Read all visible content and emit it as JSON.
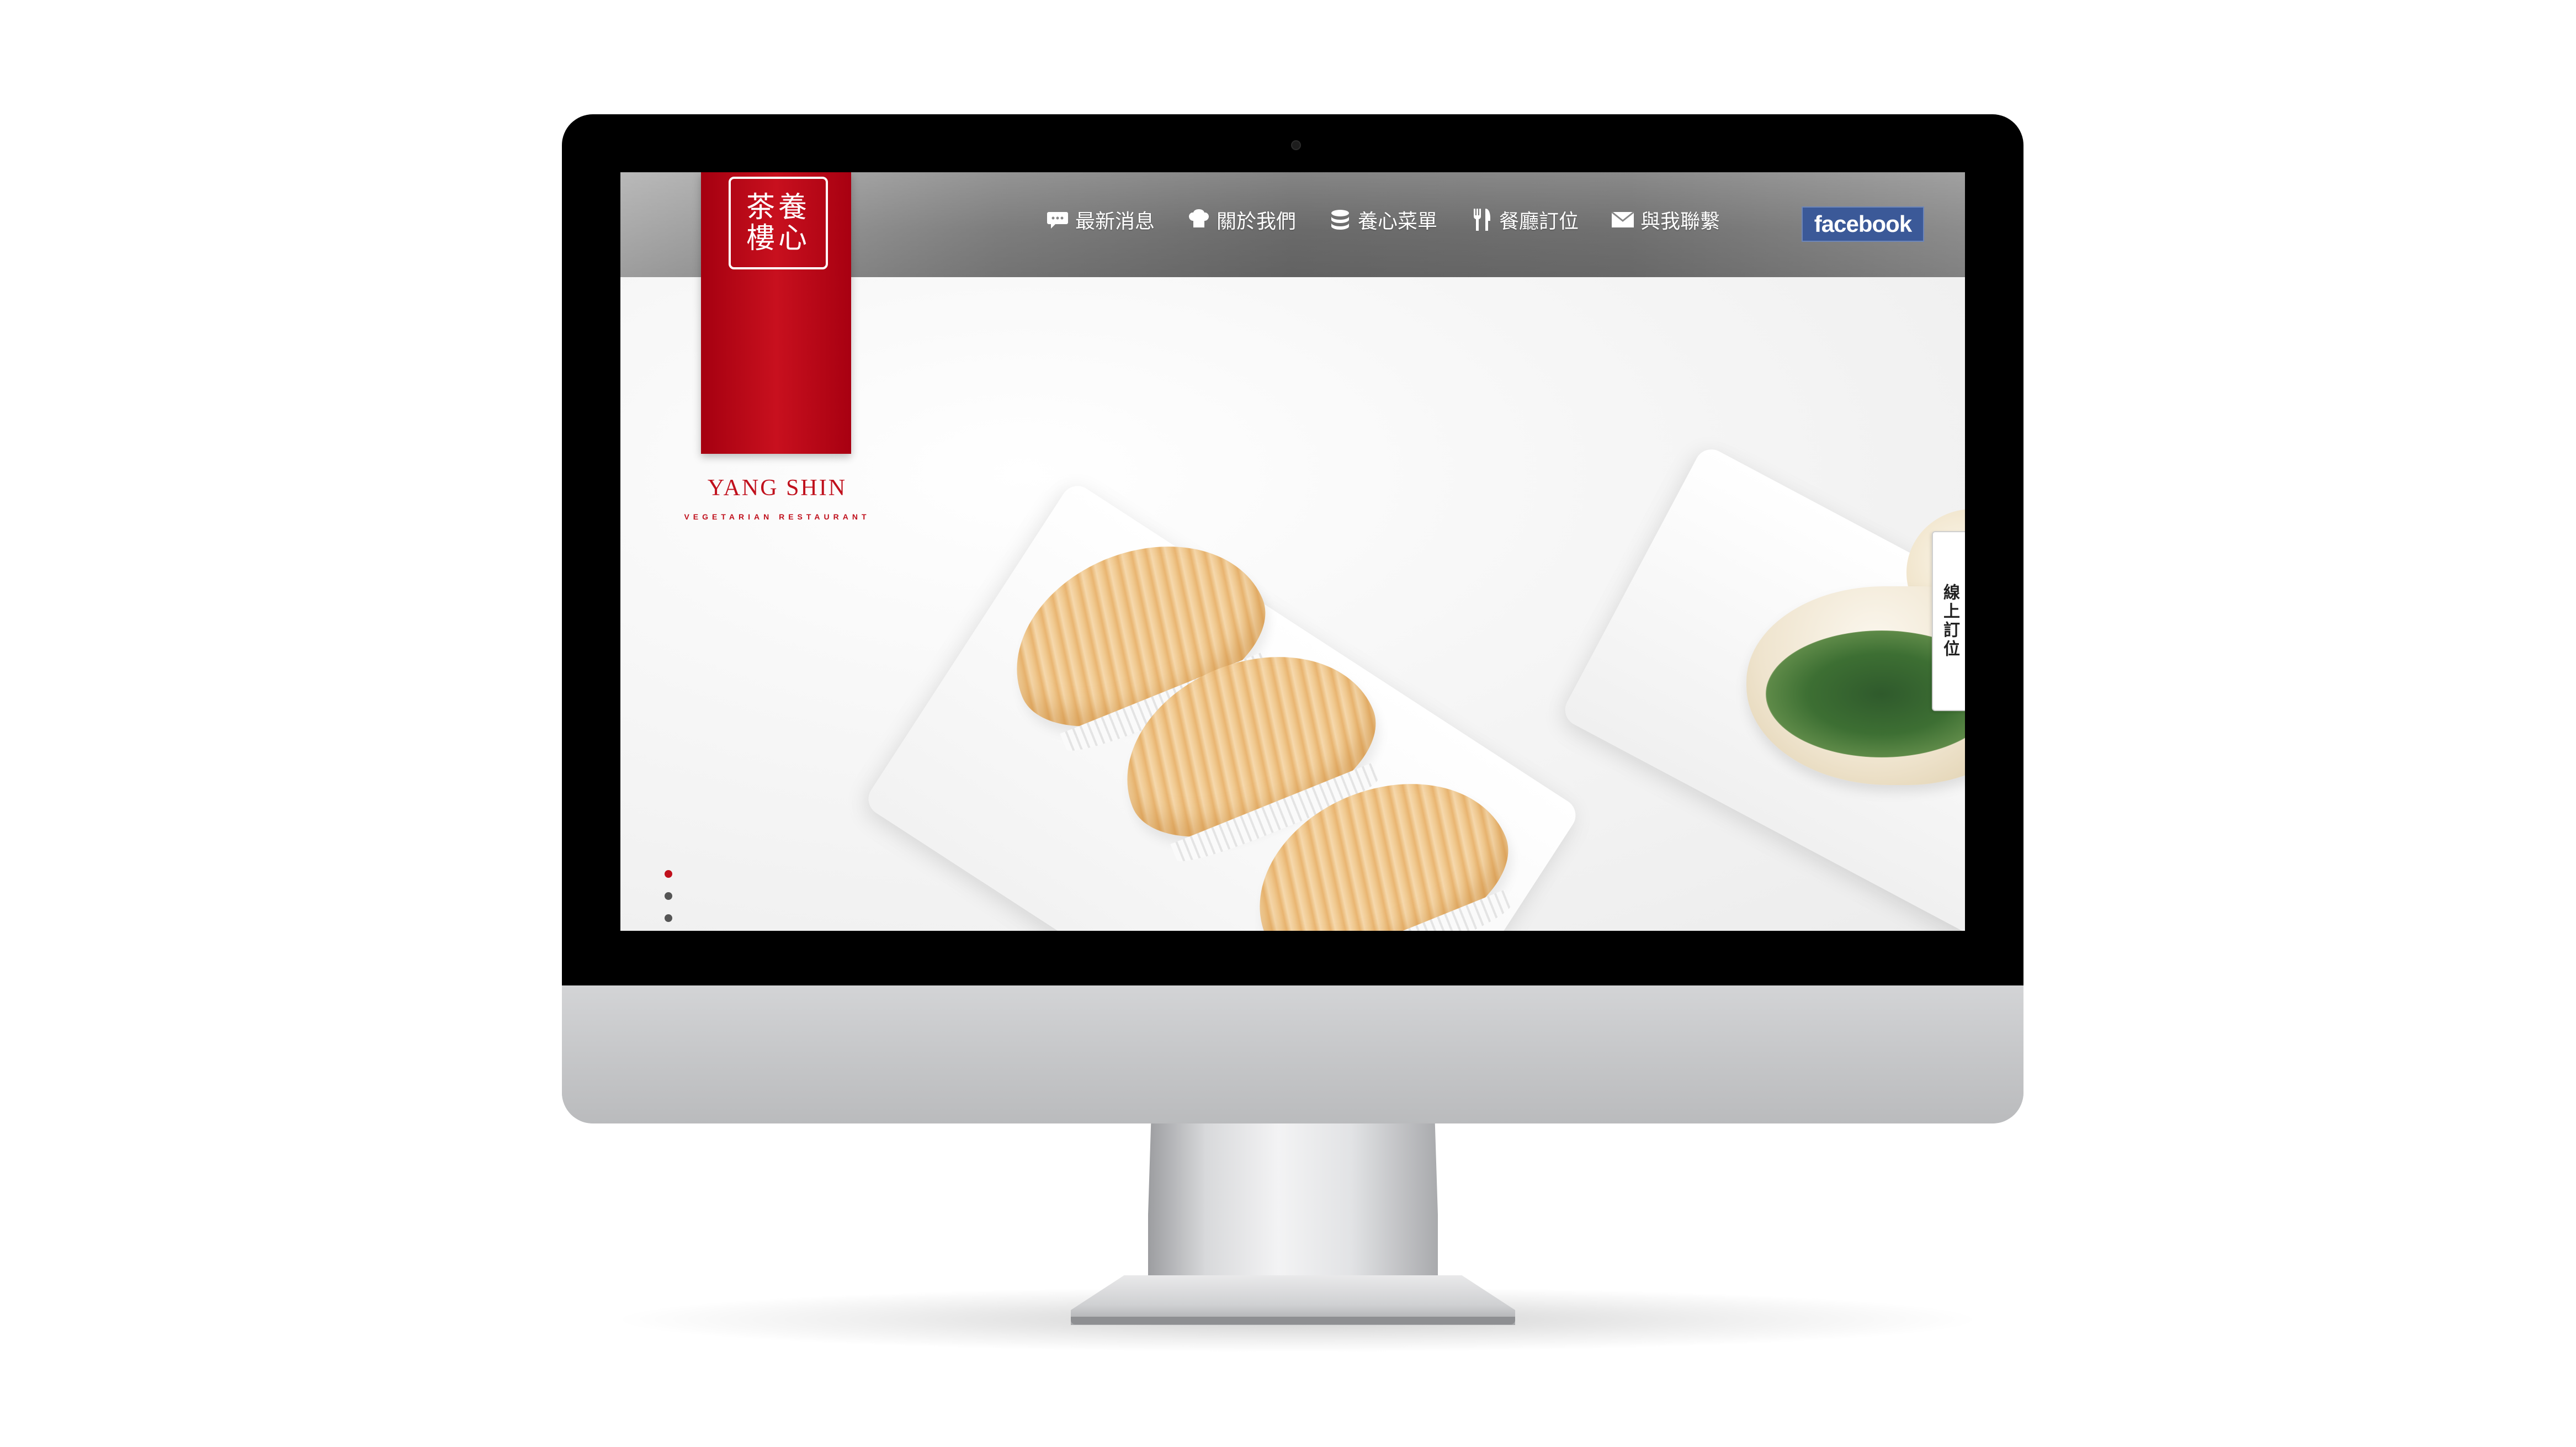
{
  "site": {
    "brand_name": "YANG SHIN",
    "brand_subtitle": "VEGETARIAN RESTAURANT",
    "logo_glyphs": "茶養樓心",
    "accent_color": "#c0101c"
  },
  "nav": {
    "items": [
      {
        "label": "最新消息",
        "icon": "speech-bubble-icon"
      },
      {
        "label": "關於我們",
        "icon": "chef-hat-icon"
      },
      {
        "label": "養心菜單",
        "icon": "menu-stack-icon"
      },
      {
        "label": "餐廳訂位",
        "icon": "fork-knife-icon"
      },
      {
        "label": "與我聯繫",
        "icon": "envelope-icon"
      }
    ],
    "facebook_label": "facebook"
  },
  "side_tab": {
    "label": "線上訂位"
  },
  "slider": {
    "dot_count": 3,
    "active_index": 0
  }
}
